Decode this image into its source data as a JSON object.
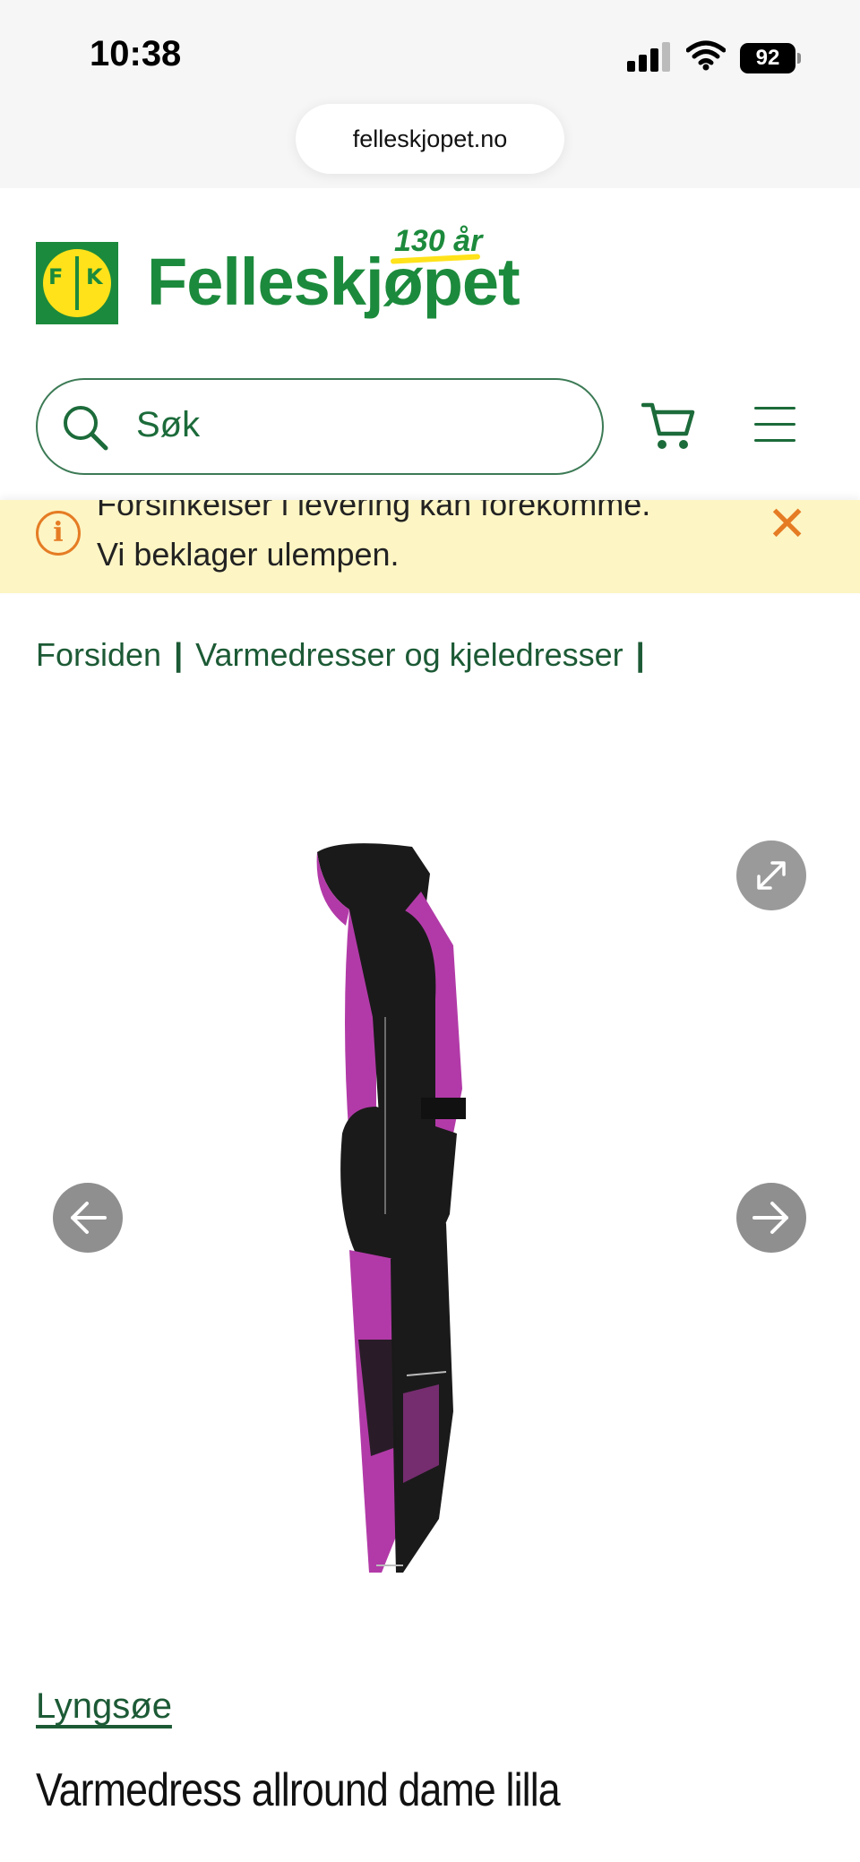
{
  "status_bar": {
    "time": "10:38",
    "battery": "92"
  },
  "browser": {
    "url": "felleskjopet.no"
  },
  "header": {
    "brand": "Felleskjøpet",
    "anniversary": "130 år",
    "logo_letters": {
      "left": "F",
      "right": "K"
    }
  },
  "search": {
    "placeholder": "Søk"
  },
  "notice": {
    "line1": "Forsinkelser i levering kan forekomme.",
    "line2": "Vi beklager ulempen."
  },
  "breadcrumb": {
    "items": [
      "Forsiden",
      "Varmedresser og kjeledresser"
    ],
    "separator": "|"
  },
  "product": {
    "brand": "Lyngsøe",
    "title": "Varmedress allround dame lilla",
    "colors": {
      "primary": "#1a1a1a",
      "accent": "#b23aa8"
    }
  },
  "icons": {
    "search": "search-icon",
    "cart": "cart-icon",
    "menu": "hamburger-menu-icon",
    "info": "info-icon",
    "close": "close-icon",
    "expand": "expand-icon",
    "prev": "arrow-left-icon",
    "next": "arrow-right-icon"
  },
  "colors": {
    "brand_green": "#1c8a3c",
    "brand_yellow": "#ffe21a",
    "notice_bg": "#fdf5c4",
    "notice_accent": "#e57c24"
  }
}
